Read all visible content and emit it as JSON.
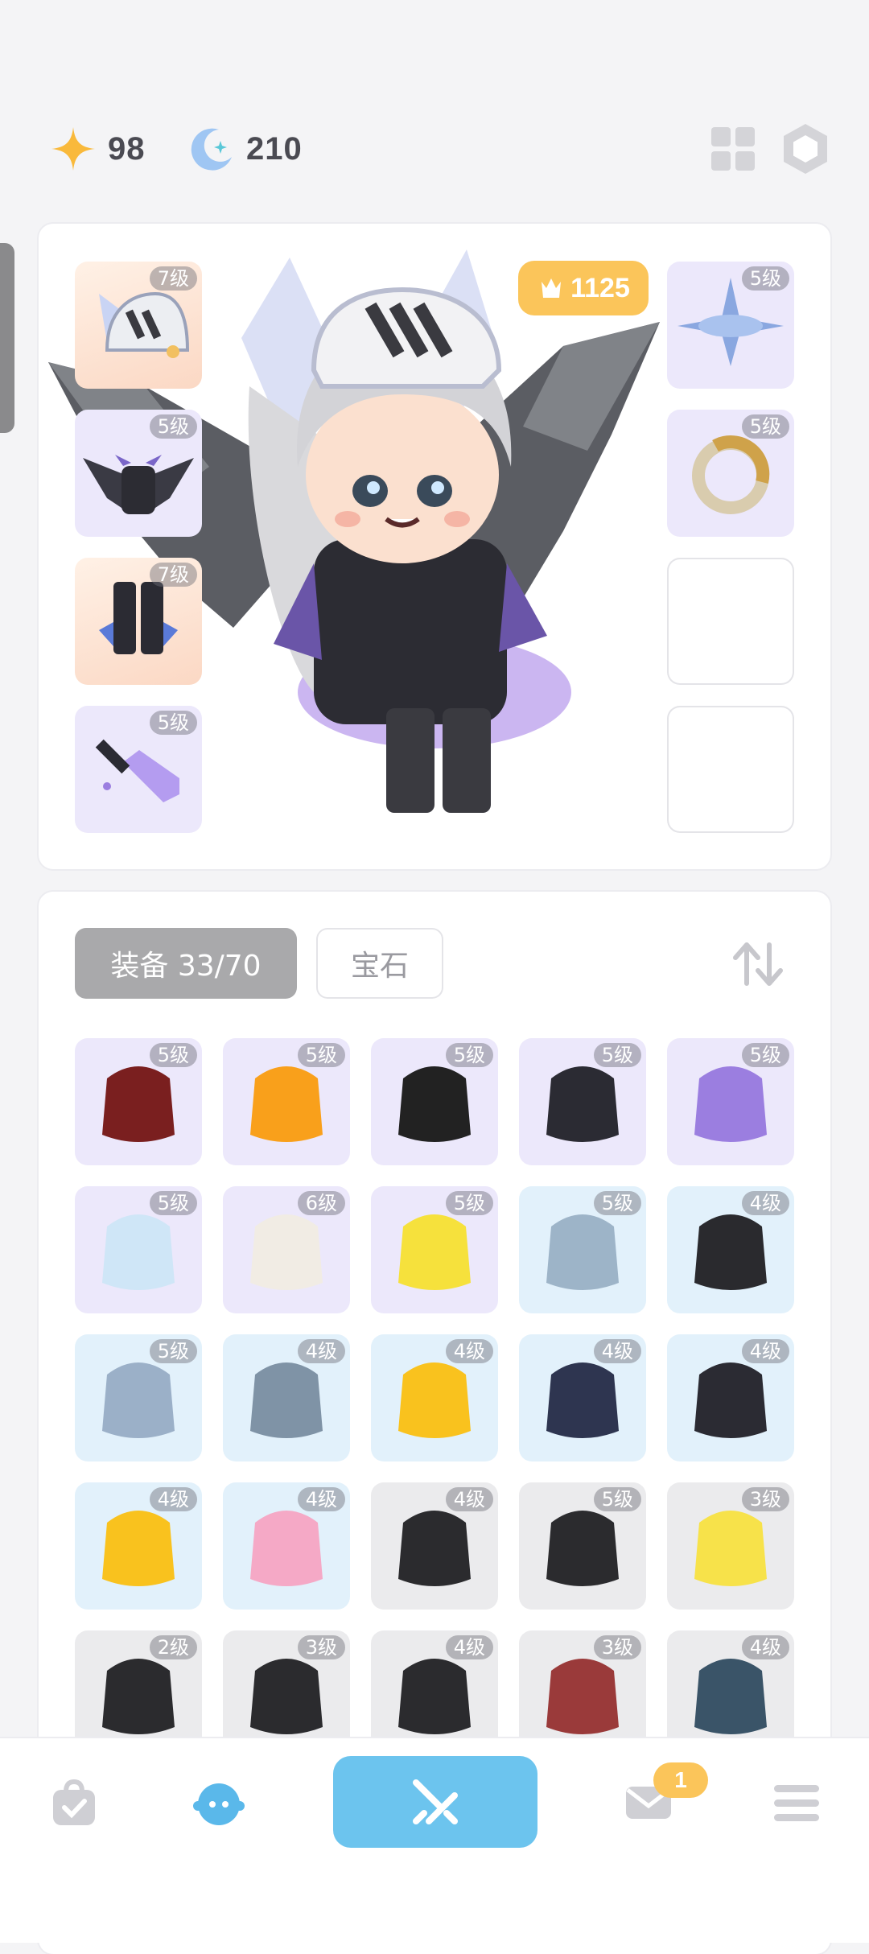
{
  "currencies": {
    "star": {
      "value": "98",
      "icon": "star-icon",
      "color": "#f9b93b"
    },
    "moon": {
      "value": "210",
      "icon": "moon-icon",
      "color": "#7ab8f0"
    }
  },
  "top_icons": [
    "grid-icon",
    "hexagon-settings-icon"
  ],
  "hero": {
    "power": "1125",
    "power_icon": "crown-icon",
    "left_slots": [
      {
        "level": "7级",
        "item": "winged-helmet-icon",
        "rarity": "orange"
      },
      {
        "level": "5级",
        "item": "bat-wings-icon",
        "rarity": "purple"
      },
      {
        "level": "7级",
        "item": "dark-boots-icon",
        "rarity": "orange"
      },
      {
        "level": "5级",
        "item": "crystal-sword-icon",
        "rarity": "purple"
      }
    ],
    "right_slots": [
      {
        "level": "5级",
        "item": "spinning-top-icon",
        "rarity": "purple"
      },
      {
        "level": "5级",
        "item": "serpent-ring-icon",
        "rarity": "purple"
      },
      {
        "level": "",
        "item": "",
        "rarity": "empty"
      },
      {
        "level": "",
        "item": "",
        "rarity": "empty"
      }
    ]
  },
  "inventory": {
    "tabs": {
      "equip": "装备 33/70",
      "gem": "宝石"
    },
    "sort_icon": "sort-arrows-icon",
    "items": [
      {
        "level": "5级",
        "item": "red-cape-icon",
        "rarity": "purple",
        "color": "#7a1f1f"
      },
      {
        "level": "5级",
        "item": "fire-sword-icon",
        "rarity": "purple",
        "color": "#f9a01b"
      },
      {
        "level": "5级",
        "item": "katana-icon",
        "rarity": "purple",
        "color": "#222222"
      },
      {
        "level": "5级",
        "item": "dark-boots-icon",
        "rarity": "purple",
        "color": "#2b2b33"
      },
      {
        "level": "5级",
        "item": "crystal-staff-icon",
        "rarity": "purple",
        "color": "#9b7ee0"
      },
      {
        "level": "5级",
        "item": "blue-helmet-icon",
        "rarity": "purple",
        "color": "#cfe6f7"
      },
      {
        "level": "6级",
        "item": "white-boots-icon",
        "rarity": "purple",
        "color": "#f1ece4"
      },
      {
        "level": "5级",
        "item": "black-hole-icon",
        "rarity": "purple",
        "color": "#f6e13c"
      },
      {
        "level": "5级",
        "item": "shark-hat-icon",
        "rarity": "blue",
        "color": "#9db4c8"
      },
      {
        "level": "4级",
        "item": "wing-shirt-icon",
        "rarity": "blue",
        "color": "#2a2a2e"
      },
      {
        "level": "5级",
        "item": "gray-pants-icon",
        "rarity": "blue",
        "color": "#9bb0c8"
      },
      {
        "level": "4级",
        "item": "fish-bone-icon",
        "rarity": "blue",
        "color": "#7f93a6"
      },
      {
        "level": "4级",
        "item": "golden-wings-icon",
        "rarity": "blue",
        "color": "#f9c21e"
      },
      {
        "level": "4级",
        "item": "dark-armor-icon",
        "rarity": "blue",
        "color": "#2e3550"
      },
      {
        "level": "4级",
        "item": "claw-boots-icon",
        "rarity": "blue",
        "color": "#2b2b33"
      },
      {
        "level": "4级",
        "item": "gold-crown-wings-icon",
        "rarity": "blue",
        "color": "#f9c21e"
      },
      {
        "level": "4级",
        "item": "pink-sword-icon",
        "rarity": "blue",
        "color": "#f5a9c6"
      },
      {
        "level": "4级",
        "item": "witch-hat-icon",
        "rarity": "gray",
        "color": "#2b2b2e"
      },
      {
        "level": "5级",
        "item": "black-hood-icon",
        "rarity": "gray",
        "color": "#2b2b2e"
      },
      {
        "level": "3级",
        "item": "yellow-chick-icon",
        "rarity": "gray",
        "color": "#f7e24a"
      },
      {
        "level": "2级",
        "item": "black-rock-icon",
        "rarity": "gray",
        "color": "#2b2b2e"
      },
      {
        "level": "3级",
        "item": "black-armor-icon",
        "rarity": "gray",
        "color": "#2b2b2e"
      },
      {
        "level": "4级",
        "item": "black-boots-icon",
        "rarity": "gray",
        "color": "#2b2b2e"
      },
      {
        "level": "3级",
        "item": "dragon-sword-icon",
        "rarity": "gray",
        "color": "#9a3a3a"
      },
      {
        "level": "4级",
        "item": "teal-cloak-icon",
        "rarity": "gray",
        "color": "#3a5468"
      }
    ]
  },
  "bottom_nav": {
    "items": [
      "bag-icon",
      "character-icon",
      "battle-swords-icon",
      "mail-icon",
      "menu-icon"
    ],
    "mail_badge": "1",
    "active_color": "#6cc4ee"
  }
}
